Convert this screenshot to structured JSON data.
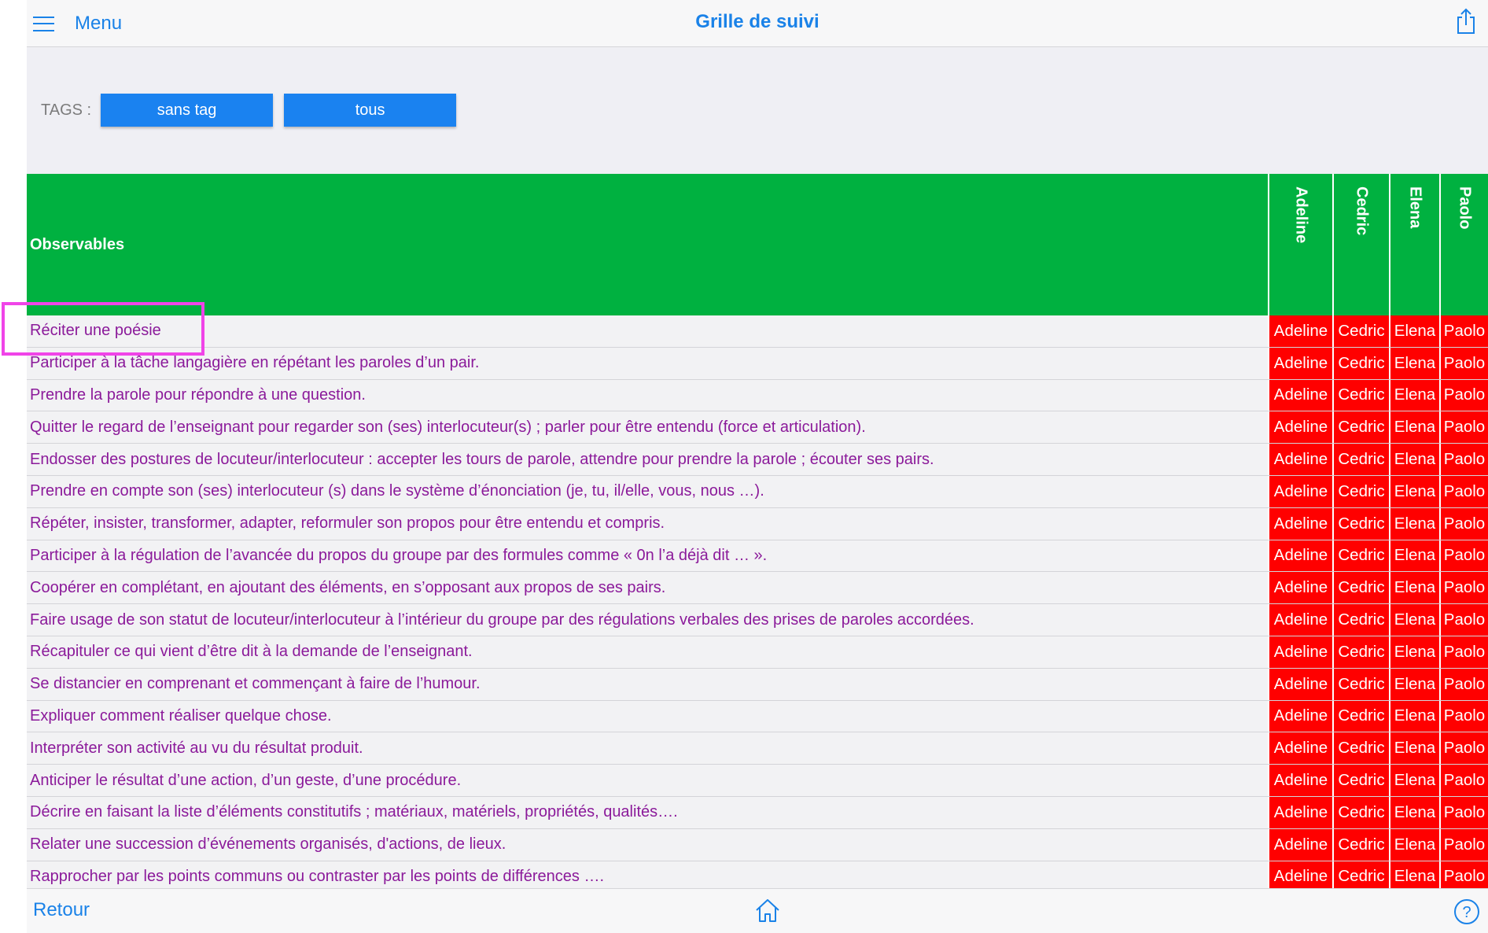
{
  "header": {
    "menu_label": "Menu",
    "title": "Grille de suivi"
  },
  "tags": {
    "label": "TAGS :",
    "buttons": [
      "sans tag",
      "tous"
    ]
  },
  "table": {
    "observables_header": "Observables",
    "students": [
      "Adeline",
      "Cedric",
      "Elena",
      "Paolo"
    ],
    "rows": [
      "Réciter une poésie",
      "Participer à la tâche langagière en répétant les paroles d’un pair.",
      "Prendre la parole pour répondre à une question.",
      "Quitter le regard de l’enseignant pour regarder son (ses) interlocuteur(s) ; parler pour être entendu (force et articulation).",
      "Endosser des postures de locuteur/interlocuteur : accepter les tours de parole, attendre pour prendre la parole ; écouter ses pairs.",
      "Prendre en compte son (ses) interlocuteur (s) dans le système d’énonciation (je, tu, il/elle, vous, nous …).",
      "Répéter, insister, transformer, adapter, reformuler son propos pour être entendu et compris.",
      "Participer à la régulation de l’avancée du propos du groupe par des formules comme « 0n l’a déjà dit … ».",
      "Coopérer en complétant, en ajoutant des éléments, en s’opposant aux propos de ses pairs.",
      "Faire usage de son statut de locuteur/interlocuteur à l’intérieur du groupe par des régulations verbales des prises de paroles accordées.",
      "Récapituler ce qui vient d’être dit à la demande de l’enseignant.",
      "Se distancier en comprenant et commençant à faire de l’humour.",
      "Expliquer comment réaliser quelque chose.",
      "Interpréter son activité au vu du résultat produit.",
      "Anticiper le résultat d’une action, d’un geste, d’une procédure.",
      "Décrire en faisant la liste d’éléments constitutifs ; matériaux, matériels, propriétés, qualités….",
      "Relater une succession d’événements organisés, d'actions, de lieux.",
      "Rapprocher par les points communs ou contraster par les points de différences …."
    ]
  },
  "footer": {
    "back_label": "Retour"
  },
  "icons": {
    "menu": "hamburger-icon",
    "share": "share-icon",
    "home": "home-icon",
    "help": "help-icon"
  },
  "colors": {
    "accent": "#1a82e8",
    "header_green": "#00b140",
    "cell_red": "#ff0000",
    "row_text": "#8b1a9a",
    "highlight": "#f044e8"
  }
}
